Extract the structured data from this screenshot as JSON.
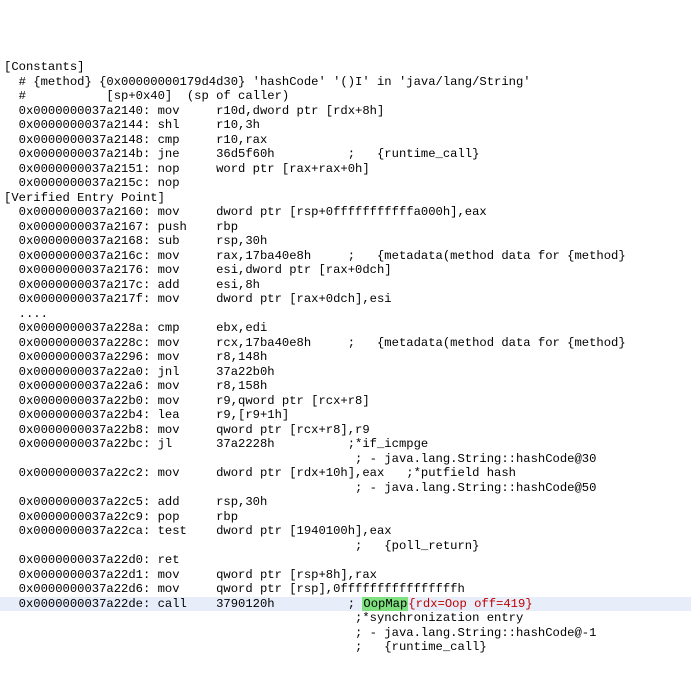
{
  "lines": [
    {
      "text": "[Constants]"
    },
    {
      "text": "  # {method} {0x00000000179d4d30} 'hashCode' '()I' in 'java/lang/String'"
    },
    {
      "text": "  #           [sp+0x40]  (sp of caller)"
    },
    {
      "text": "  0x0000000037a2140: mov     r10d,dword ptr [rdx+8h]"
    },
    {
      "text": "  0x0000000037a2144: shl     r10,3h"
    },
    {
      "text": "  0x0000000037a2148: cmp     r10,rax"
    },
    {
      "text": "  0x0000000037a214b: jne     36d5f60h          ;   {runtime_call}"
    },
    {
      "text": "  0x0000000037a2151: nop     word ptr [rax+rax+0h]"
    },
    {
      "text": "  0x0000000037a215c: nop"
    },
    {
      "text": "[Verified Entry Point]"
    },
    {
      "text": "  0x0000000037a2160: mov     dword ptr [rsp+0fffffffffffa000h],eax"
    },
    {
      "text": "  0x0000000037a2167: push    rbp"
    },
    {
      "text": "  0x0000000037a2168: sub     rsp,30h"
    },
    {
      "text": "  0x0000000037a216c: mov     rax,17ba40e8h     ;   {metadata(method data for {method}"
    },
    {
      "text": "  0x0000000037a2176: mov     esi,dword ptr [rax+0dch]"
    },
    {
      "text": "  0x0000000037a217c: add     esi,8h"
    },
    {
      "text": "  0x0000000037a217f: mov     dword ptr [rax+0dch],esi"
    },
    {
      "text": "  ...."
    },
    {
      "text": "  0x0000000037a228a: cmp     ebx,edi"
    },
    {
      "text": "  0x0000000037a228c: mov     rcx,17ba40e8h     ;   {metadata(method data for {method}"
    },
    {
      "text": "  0x0000000037a2296: mov     r8,148h"
    },
    {
      "text": "  0x0000000037a22a0: jnl     37a22b0h"
    },
    {
      "text": "  0x0000000037a22a6: mov     r8,158h"
    },
    {
      "text": "  0x0000000037a22b0: mov     r9,qword ptr [rcx+r8]"
    },
    {
      "text": "  0x0000000037a22b4: lea     r9,[r9+1h]"
    },
    {
      "text": "  0x0000000037a22b8: mov     qword ptr [rcx+r8],r9"
    },
    {
      "text": "  0x0000000037a22bc: jl      37a2228h          ;*if_icmpge"
    },
    {
      "text": "                                                ; - java.lang.String::hashCode@30"
    },
    {
      "text": ""
    },
    {
      "text": "  0x0000000037a22c2: mov     dword ptr [rdx+10h],eax   ;*putfield hash"
    },
    {
      "text": "                                                ; - java.lang.String::hashCode@50"
    },
    {
      "text": ""
    },
    {
      "text": "  0x0000000037a22c5: add     rsp,30h"
    },
    {
      "text": "  0x0000000037a22c9: pop     rbp"
    },
    {
      "text": "  0x0000000037a22ca: test    dword ptr [1940100h],eax"
    },
    {
      "text": "                                                ;   {poll_return}"
    },
    {
      "text": "  0x0000000037a22d0: ret"
    },
    {
      "text": "  0x0000000037a22d1: mov     qword ptr [rsp+8h],rax"
    },
    {
      "text": "  0x0000000037a22d6: mov     qword ptr [rsp],0ffffffffffffffffh"
    },
    {
      "text": "  0x0000000037a22de: call    3790120h          ; ",
      "selected": true,
      "oopmap": "OopMap",
      "curly": "{rdx=Oop off=419}"
    },
    {
      "text": "                                                ;*synchronization entry"
    },
    {
      "text": "                                                ; - java.lang.String::hashCode@-1"
    },
    {
      "text": "                                                ;   {runtime_call}"
    }
  ]
}
